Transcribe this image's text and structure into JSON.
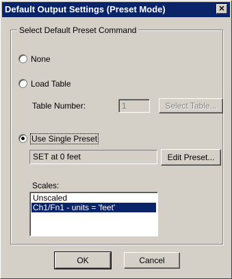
{
  "window": {
    "title": "Default Output Settings (Preset Mode)",
    "close_glyph": "✕"
  },
  "group": {
    "legend": "Select Default Preset Command"
  },
  "options": {
    "none": {
      "label": "None",
      "checked": false
    },
    "load_table": {
      "label": "Load Table",
      "checked": false
    },
    "use_single_preset": {
      "label": "Use Single Preset",
      "checked": true
    }
  },
  "table": {
    "number_label": "Table Number:",
    "number_value": "1",
    "select_button": "Select Table..."
  },
  "preset": {
    "value": "SET at 0 feet",
    "edit_button": "Edit Preset..."
  },
  "scales": {
    "label": "Scales:",
    "items": [
      {
        "label": "Unscaled",
        "selected": false
      },
      {
        "label": "Ch1/Fn1 - units = 'feet'",
        "selected": true
      }
    ]
  },
  "buttons": {
    "ok": "OK",
    "cancel": "Cancel"
  }
}
